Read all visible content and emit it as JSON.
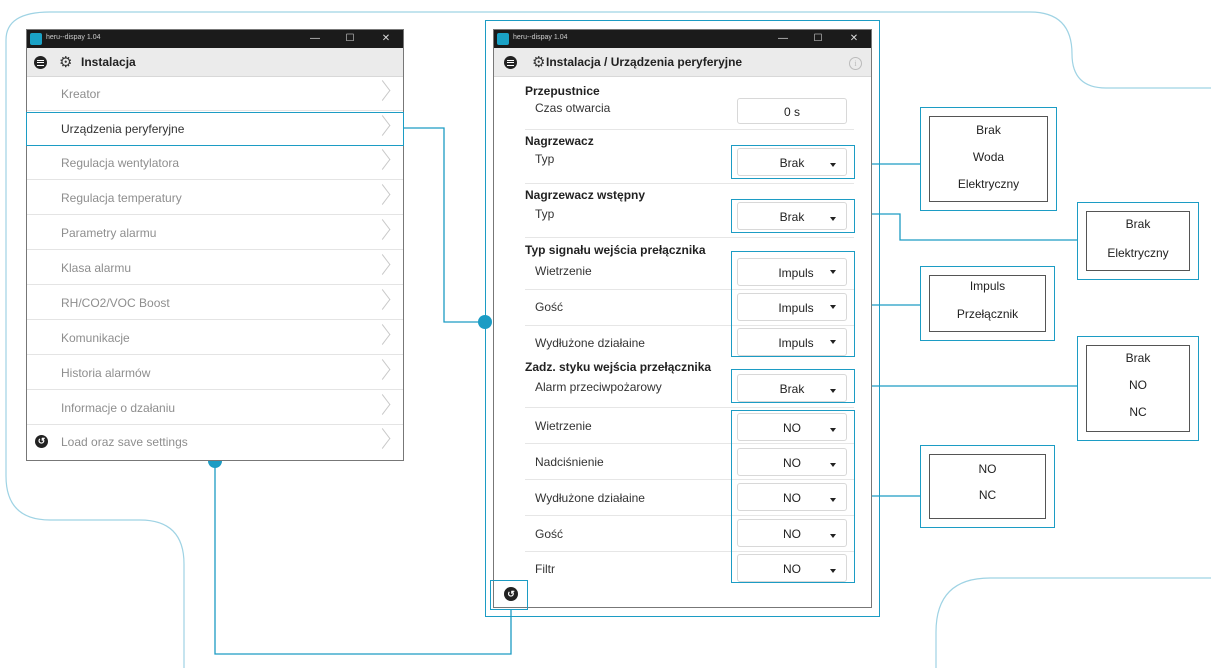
{
  "left_window": {
    "app_title": "heru--dispay 1.04",
    "header_title": "Instalacja",
    "menu_items": [
      {
        "label": "Kreator"
      },
      {
        "label": "Urządzenia peryferyjne"
      },
      {
        "label": "Regulacja wentylatora"
      },
      {
        "label": "Regulacja temperatury"
      },
      {
        "label": "Parametry alarmu"
      },
      {
        "label": "Klasa alarmu"
      },
      {
        "label": "RH/CO2/VOC Boost"
      },
      {
        "label": "Komunikacje"
      },
      {
        "label": "Historia alarmów"
      },
      {
        "label": "Informacje o dzałaniu"
      },
      {
        "label": "Load oraz save settings"
      }
    ]
  },
  "right_window": {
    "app_title": "heru--dispay 1.04",
    "header_title": "Instalacja / Urządzenia peryferyjne",
    "sections": {
      "przepustnice": "Przepustnice",
      "nagrzewacz": "Nagrzewacz",
      "nagrzewacz_wstepny": "Nagrzewacz wstępny",
      "typ_sygnalu": "Typ signału wejścia prełącznika",
      "zadz_styku": "Zadz. styku wejścia przełącznika"
    },
    "rows": {
      "czas_otwarcia": {
        "label": "Czas otwarcia",
        "value": "0 s"
      },
      "nagrzewacz_typ": {
        "label": "Typ",
        "value": "Brak"
      },
      "wstepny_typ": {
        "label": "Typ",
        "value": "Brak"
      },
      "sig_wietrzenie": {
        "label": "Wietrzenie",
        "value": "Impuls"
      },
      "sig_gosc": {
        "label": "Gość",
        "value": "Impuls"
      },
      "sig_wydluzone": {
        "label": "Wydłużone działaine",
        "value": "Impuls"
      },
      "alarm_przeciwpozarowy": {
        "label": "Alarm przeciwpożarowy",
        "value": "Brak"
      },
      "st_wietrzenie": {
        "label": "Wietrzenie",
        "value": "NO"
      },
      "st_nadcisnienie": {
        "label": "Nadciśnienie",
        "value": "NO"
      },
      "st_wydluzone": {
        "label": "Wydłużone działaine",
        "value": "NO"
      },
      "st_gosc": {
        "label": "Gość",
        "value": "NO"
      },
      "st_filtr": {
        "label": "Filtr",
        "value": "NO"
      }
    }
  },
  "option_boxes": {
    "nagrzewacz": [
      "Brak",
      "Woda",
      "Elektryczny"
    ],
    "wstepny": [
      "Brak",
      "Elektryczny"
    ],
    "sygnal": [
      "Impuls",
      "Przełącznik"
    ],
    "alarm": [
      "Brak",
      "NO",
      "NC"
    ],
    "styk": [
      "NO",
      "NC"
    ]
  },
  "colors": {
    "accent": "#1c9cc4",
    "titlebar": "#1b1b1b"
  }
}
